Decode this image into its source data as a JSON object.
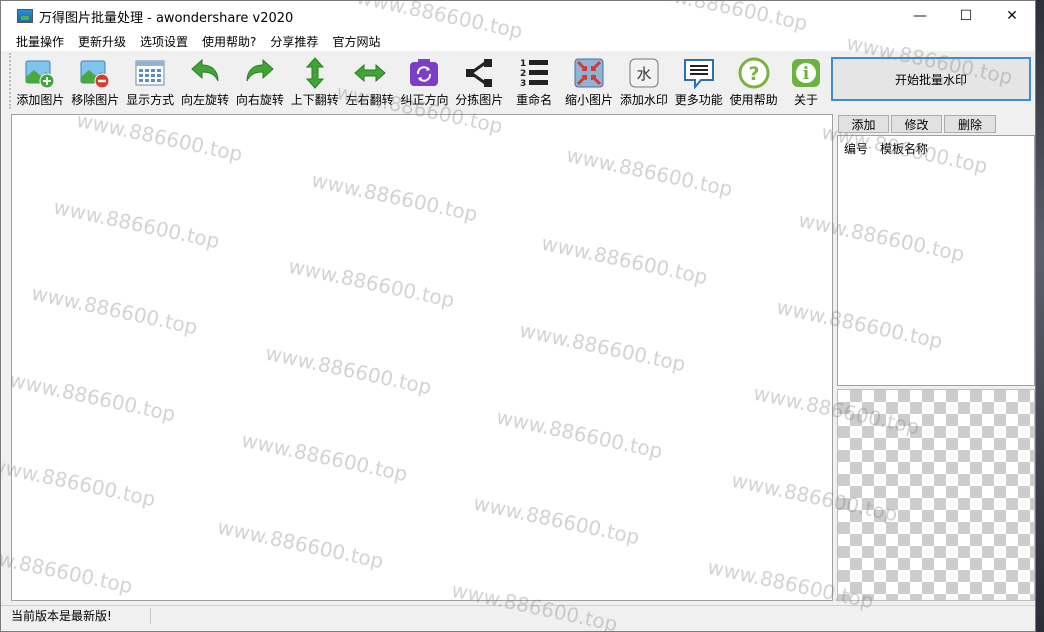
{
  "window": {
    "title": "万得图片批量处理 - awondershare v2020",
    "controls": {
      "minimize": "—",
      "maximize": "☐",
      "close": "✕"
    }
  },
  "menu": [
    "批量操作",
    "更新升级",
    "选项设置",
    "使用帮助?",
    "分享推荐",
    "官方网站"
  ],
  "toolbar": [
    {
      "label": "添加图片",
      "icon": "add-image-icon"
    },
    {
      "label": "移除图片",
      "icon": "remove-image-icon"
    },
    {
      "label": "显示方式",
      "icon": "display-mode-icon"
    },
    {
      "label": "向左旋转",
      "icon": "rotate-left-icon"
    },
    {
      "label": "向右旋转",
      "icon": "rotate-right-icon"
    },
    {
      "label": "上下翻转",
      "icon": "flip-vertical-icon"
    },
    {
      "label": "左右翻转",
      "icon": "flip-horizontal-icon"
    },
    {
      "label": "纠正方向",
      "icon": "correct-orientation-icon"
    },
    {
      "label": "分拣图片",
      "icon": "sort-images-icon"
    },
    {
      "label": "重命名",
      "icon": "rename-icon"
    },
    {
      "label": "缩小图片",
      "icon": "shrink-image-icon"
    },
    {
      "label": "添加水印",
      "icon": "watermark-icon",
      "glyph": "水"
    },
    {
      "label": "更多功能",
      "icon": "more-features-icon"
    },
    {
      "label": "使用帮助",
      "icon": "help-icon",
      "glyph": "?"
    },
    {
      "label": "关于",
      "icon": "about-icon",
      "glyph": "i"
    }
  ],
  "start_button": "开始批量水印",
  "template_panel": {
    "buttons": [
      "添加",
      "修改",
      "删除"
    ],
    "columns": [
      "编号",
      "模板名称"
    ]
  },
  "status": {
    "text": "当前版本是最新版!"
  },
  "watermark_text": "www.886600.top",
  "rename_numbers": [
    "1",
    "2",
    "3"
  ],
  "colors": {
    "green": "#3fa535",
    "purple": "#7a3fc4",
    "blue_accent": "#3c8dd6",
    "red": "#d83a2e"
  }
}
